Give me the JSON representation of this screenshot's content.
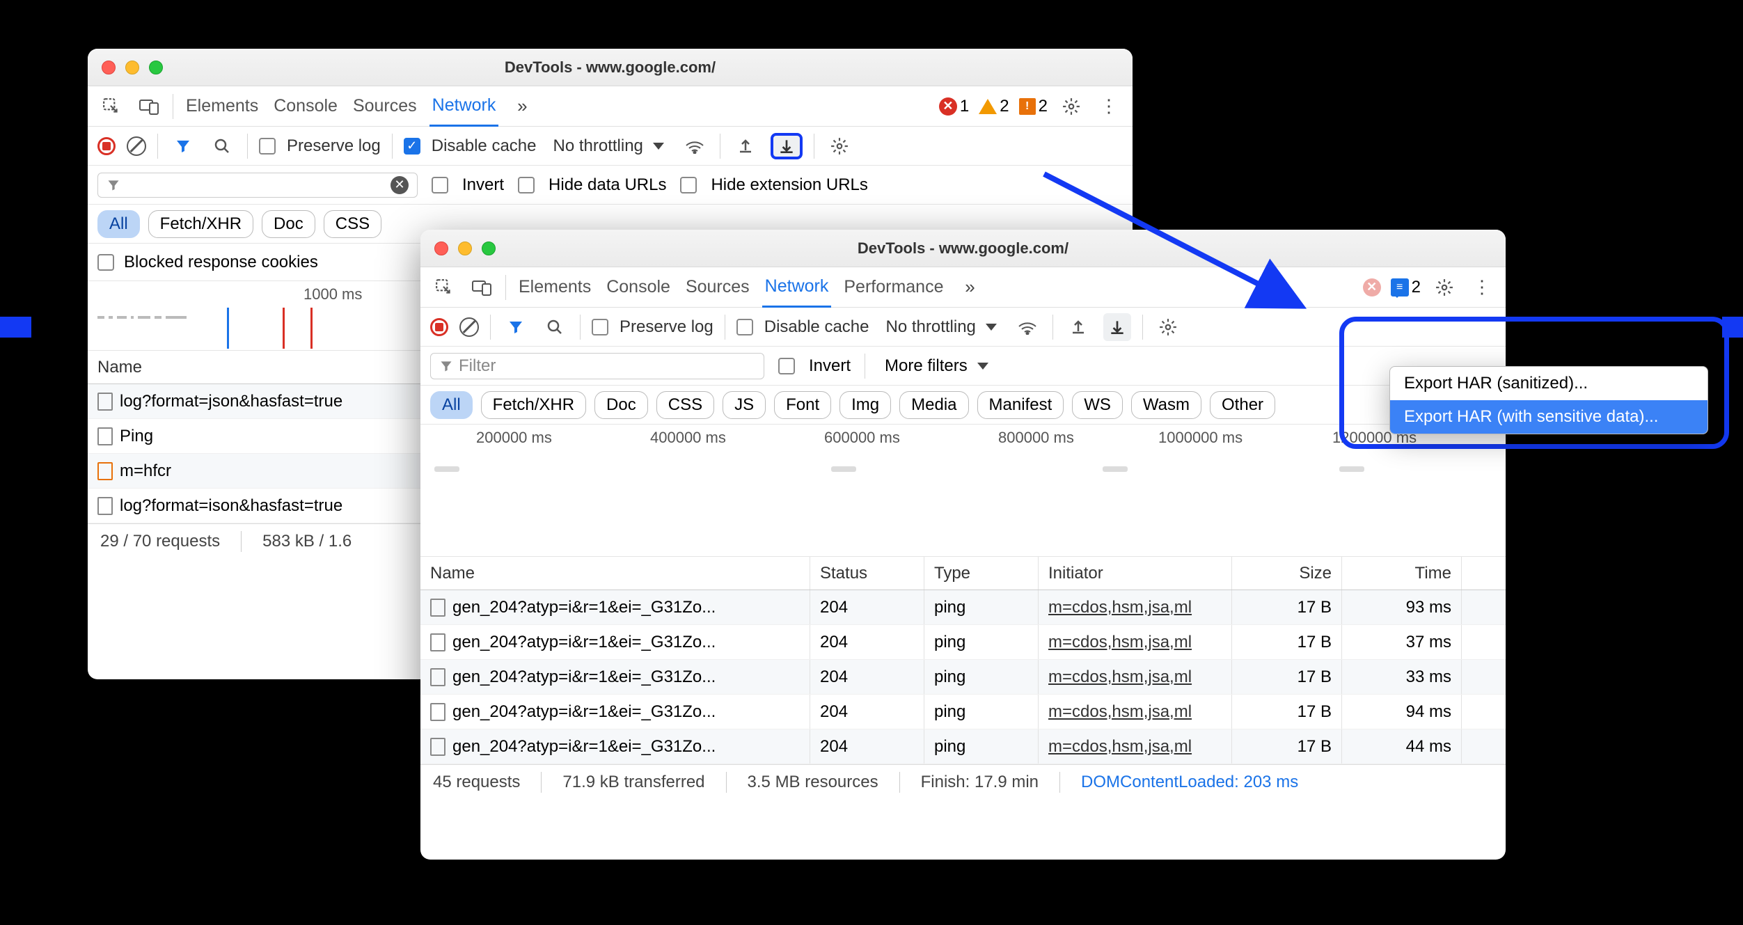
{
  "windowA": {
    "title": "DevTools - www.google.com/",
    "tabs": [
      "Elements",
      "Console",
      "Sources",
      "Network"
    ],
    "activeTab": "Network",
    "errors": "1",
    "warnings": "2",
    "issues": "2",
    "preserve_log": "Preserve log",
    "disable_cache": "Disable cache",
    "throttle": "No throttling",
    "invert": "Invert",
    "hide_data": "Hide data URLs",
    "hide_ext": "Hide extension URLs",
    "chips": [
      "All",
      "Fetch/XHR",
      "Doc",
      "CSS"
    ],
    "blocked": "Blocked response cookies",
    "timeline_label": "1000 ms",
    "col_name": "Name",
    "rows": [
      "log?format=json&hasfast=true",
      "Ping",
      "m=hfcr",
      "log?format=ison&hasfast=true"
    ],
    "status": {
      "requests": "29 / 70 requests",
      "size": "583 kB / 1.6"
    }
  },
  "windowB": {
    "title": "DevTools - www.google.com/",
    "tabs": [
      "Elements",
      "Console",
      "Sources",
      "Network",
      "Performance"
    ],
    "activeTab": "Network",
    "chat_count": "2",
    "preserve_log": "Preserve log",
    "disable_cache": "Disable cache",
    "throttle": "No throttling",
    "filter_placeholder": "Filter",
    "invert": "Invert",
    "more_filters": "More filters",
    "chips": [
      "All",
      "Fetch/XHR",
      "Doc",
      "CSS",
      "JS",
      "Font",
      "Img",
      "Media",
      "Manifest",
      "WS",
      "Wasm",
      "Other"
    ],
    "timeline_labels": [
      "200000 ms",
      "400000 ms",
      "600000 ms",
      "800000 ms",
      "1000000 ms",
      "1200000 ms"
    ],
    "cols": {
      "name": "Name",
      "status": "Status",
      "type": "Type",
      "initiator": "Initiator",
      "size": "Size",
      "time": "Time"
    },
    "rows": [
      {
        "name": "gen_204?atyp=i&r=1&ei=_G31Zo...",
        "status": "204",
        "type": "ping",
        "initiator": "m=cdos,hsm,jsa,ml",
        "size": "17 B",
        "time": "93 ms"
      },
      {
        "name": "gen_204?atyp=i&r=1&ei=_G31Zo...",
        "status": "204",
        "type": "ping",
        "initiator": "m=cdos,hsm,jsa,ml",
        "size": "17 B",
        "time": "37 ms"
      },
      {
        "name": "gen_204?atyp=i&r=1&ei=_G31Zo...",
        "status": "204",
        "type": "ping",
        "initiator": "m=cdos,hsm,jsa,ml",
        "size": "17 B",
        "time": "33 ms"
      },
      {
        "name": "gen_204?atyp=i&r=1&ei=_G31Zo...",
        "status": "204",
        "type": "ping",
        "initiator": "m=cdos,hsm,jsa,ml",
        "size": "17 B",
        "time": "94 ms"
      },
      {
        "name": "gen_204?atyp=i&r=1&ei=_G31Zo...",
        "status": "204",
        "type": "ping",
        "initiator": "m=cdos,hsm,jsa,ml",
        "size": "17 B",
        "time": "44 ms"
      }
    ],
    "status": {
      "requests": "45 requests",
      "transferred": "71.9 kB transferred",
      "resources": "3.5 MB resources",
      "finish": "Finish: 17.9 min",
      "dcl": "DOMContentLoaded: 203 ms"
    }
  },
  "exportMenu": {
    "opt1": "Export HAR (sanitized)...",
    "opt2": "Export HAR (with sensitive data)..."
  }
}
